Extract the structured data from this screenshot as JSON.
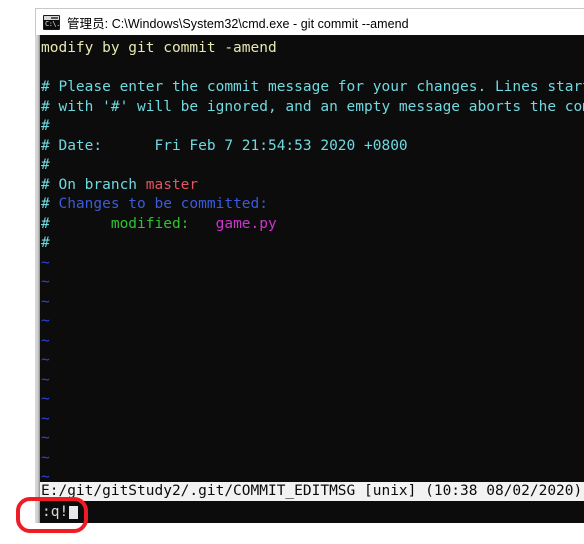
{
  "window": {
    "icon_name": "cmd-icon",
    "icon_prompt_text": "C:\\.",
    "title": "管理员: C:\\Windows\\System32\\cmd.exe - git  commit --amend"
  },
  "editor": {
    "lines": [
      {
        "segments": [
          {
            "text": "modify by git commit -amend",
            "color": "yellow"
          }
        ]
      },
      {
        "segments": [
          {
            "text": "",
            "color": "yellow"
          }
        ]
      },
      {
        "segments": [
          {
            "text": "# Please enter the commit message for your changes. Lines starting",
            "color": "cyan"
          }
        ]
      },
      {
        "segments": [
          {
            "text": "# with '#' will be ignored, and an empty message aborts the commit.",
            "color": "cyan"
          }
        ]
      },
      {
        "segments": [
          {
            "text": "#",
            "color": "cyan"
          }
        ]
      },
      {
        "segments": [
          {
            "text": "# Date:      Fri Feb 7 21:54:53 2020 +0800",
            "color": "cyan"
          }
        ]
      },
      {
        "segments": [
          {
            "text": "#",
            "color": "cyan"
          }
        ]
      },
      {
        "segments": [
          {
            "text": "# On branch ",
            "color": "cyan"
          },
          {
            "text": "master",
            "color": "red"
          }
        ]
      },
      {
        "segments": [
          {
            "text": "# ",
            "color": "cyan"
          },
          {
            "text": "Changes to be committed:",
            "color": "blue"
          }
        ]
      },
      {
        "segments": [
          {
            "text": "#       ",
            "color": "cyan"
          },
          {
            "text": "modified:   ",
            "color": "green"
          },
          {
            "text": "game.py",
            "color": "magenta"
          }
        ]
      },
      {
        "segments": [
          {
            "text": "#",
            "color": "cyan"
          }
        ]
      }
    ],
    "tilde_char": "~",
    "tilde_count": 14,
    "status_line": "E:/git/gitStudy2/.git/COMMIT_EDITMSG [unix] (10:38 08/02/2020)",
    "command_line": ":q!"
  },
  "annotation": {
    "shape": "rounded-rect",
    "color": "#ee1c25",
    "target": "command-line"
  },
  "colors": {
    "background": "#0c0c0c",
    "yellow": "#e8e8b0",
    "cyan": "#6fd9e0",
    "blue": "#3b5bdb",
    "red": "#e05561",
    "green": "#2fc22f",
    "magenta": "#cf32cf",
    "tilde": "#2b47e0",
    "status_bg": "#f2f2f2",
    "status_fg": "#0c0c0c",
    "titlebar_bg": "#ffffff",
    "annotation": "#ee1c25"
  }
}
